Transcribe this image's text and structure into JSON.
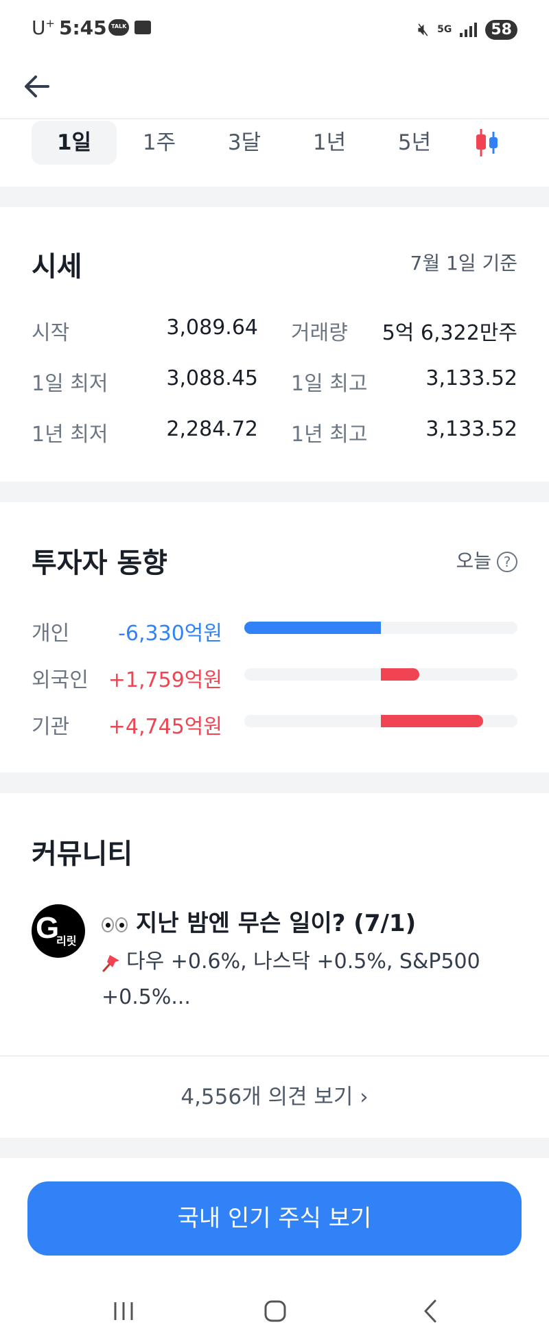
{
  "status_bar": {
    "carrier": "U",
    "carrier_sup": "+",
    "time": "5:45",
    "talk_label": "TALK",
    "network": "5G",
    "battery": "58"
  },
  "period_tabs": [
    "1일",
    "1주",
    "3달",
    "1년",
    "5년"
  ],
  "active_tab_index": 0,
  "quote": {
    "title": "시세",
    "as_of": "7월 1일 기준",
    "rows": [
      {
        "l1": "시작",
        "v1": "3,089.64",
        "l2": "거래량",
        "v2": "5억 6,322만주"
      },
      {
        "l1": "1일 최저",
        "v1": "3,088.45",
        "l2": "1일 최고",
        "v2": "3,133.52"
      },
      {
        "l1": "1년 최저",
        "v1": "2,284.72",
        "l2": "1년 최고",
        "v2": "3,133.52"
      }
    ]
  },
  "investors": {
    "title": "투자자 동향",
    "period": "오늘",
    "rows": [
      {
        "label": "개인",
        "value": "-6,330억원",
        "direction": "negative",
        "bar_fraction": -0.5
      },
      {
        "label": "외국인",
        "value": "+1,759억원",
        "direction": "positive",
        "bar_fraction": 0.14
      },
      {
        "label": "기관",
        "value": "+4,745억원",
        "direction": "positive",
        "bar_fraction": 0.37
      }
    ]
  },
  "community": {
    "title": "커뮤니티",
    "post": {
      "avatar_letter": "G",
      "avatar_sub": "리릿",
      "title": "지난 밤엔 무슨 일이? (7/1)",
      "body": "다우 +0.6%, 나스닥 +0.5%, S&P500 +0.5%..."
    },
    "opinions_link": "4,556개 의견 보기 ›"
  },
  "cta": "국내 인기 주식 보기",
  "colors": {
    "accent": "#3182f6",
    "negative": "#3182f6",
    "positive": "#f04452",
    "divider": "#f2f4f6"
  },
  "icons": [
    "back-arrow-icon",
    "candlestick-chart-icon",
    "help-icon",
    "eyes-icon",
    "pin-icon",
    "recent-apps-icon",
    "home-icon",
    "nav-back-icon"
  ]
}
